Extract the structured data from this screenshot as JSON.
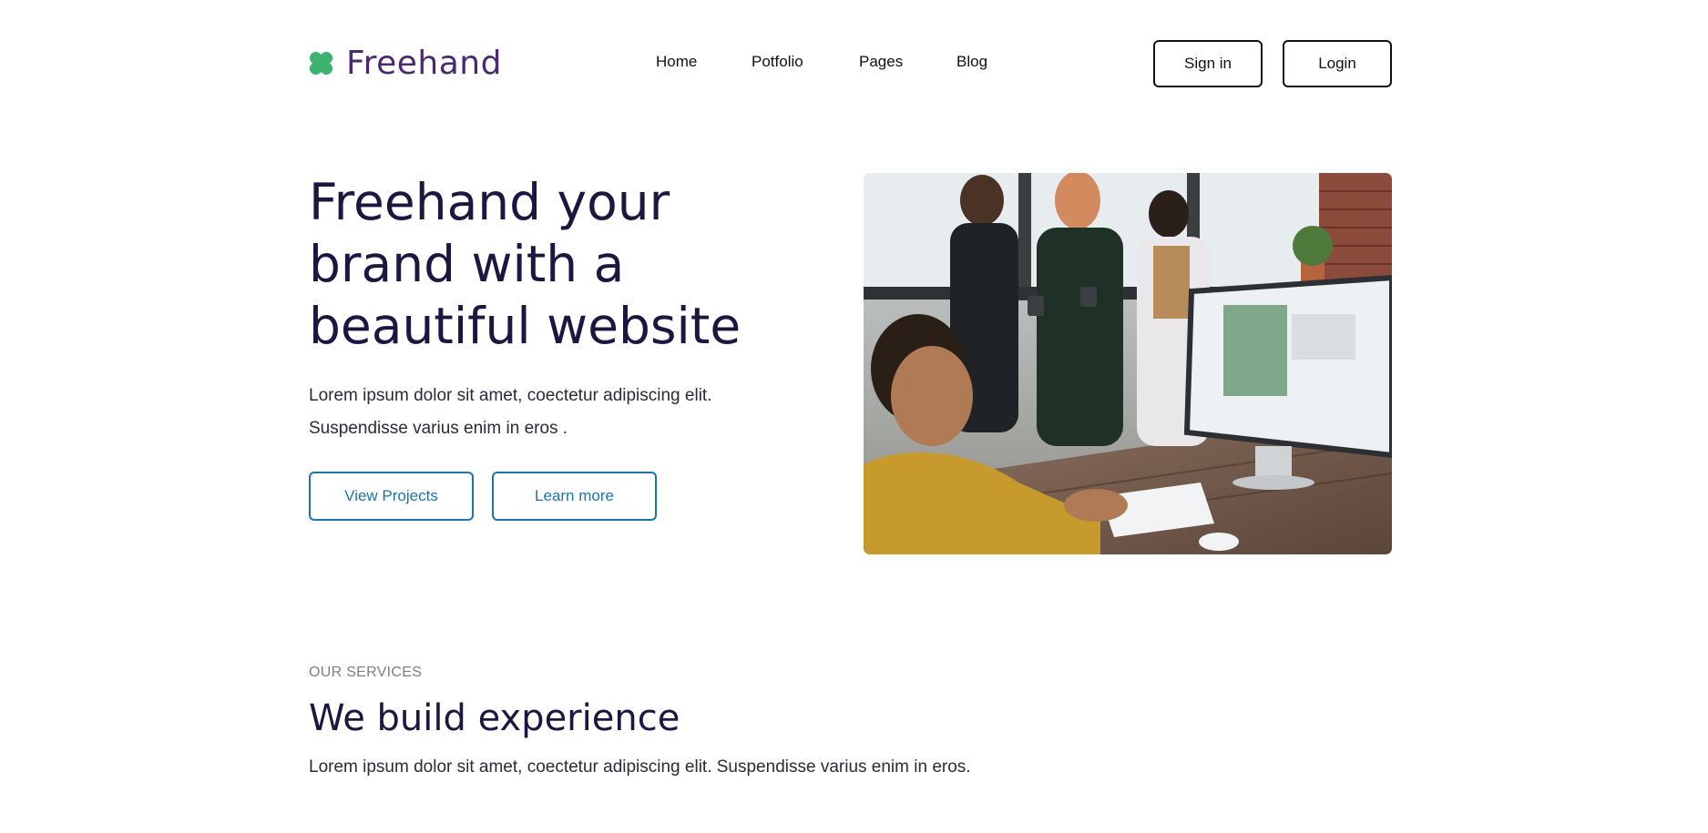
{
  "brand": {
    "name": "Freehand",
    "logo_icon": "clover-icon",
    "logo_color": "#3cb371",
    "text_color": "#4a2a6f"
  },
  "nav": {
    "items": [
      {
        "label": "Home"
      },
      {
        "label": "Potfolio"
      },
      {
        "label": "Pages"
      },
      {
        "label": "Blog"
      }
    ]
  },
  "header_actions": {
    "signin_label": "Sign in",
    "login_label": "Login"
  },
  "hero": {
    "title": "Freehand your brand with a beautiful website",
    "subtitle_line1": "Lorem ipsum dolor sit amet, coectetur adipiscing elit.",
    "subtitle_line2": "Suspendisse varius enim in eros .",
    "primary_button": "View Projects",
    "secondary_button": "Learn more",
    "button_color": "#1b75a8",
    "image_alt": "Team working in office photo"
  },
  "services": {
    "eyebrow": "OUR SERVICES",
    "title": "We build experience",
    "subtitle": "Lorem ipsum dolor sit amet, coectetur adipiscing elit. Suspendisse varius enim in eros."
  }
}
